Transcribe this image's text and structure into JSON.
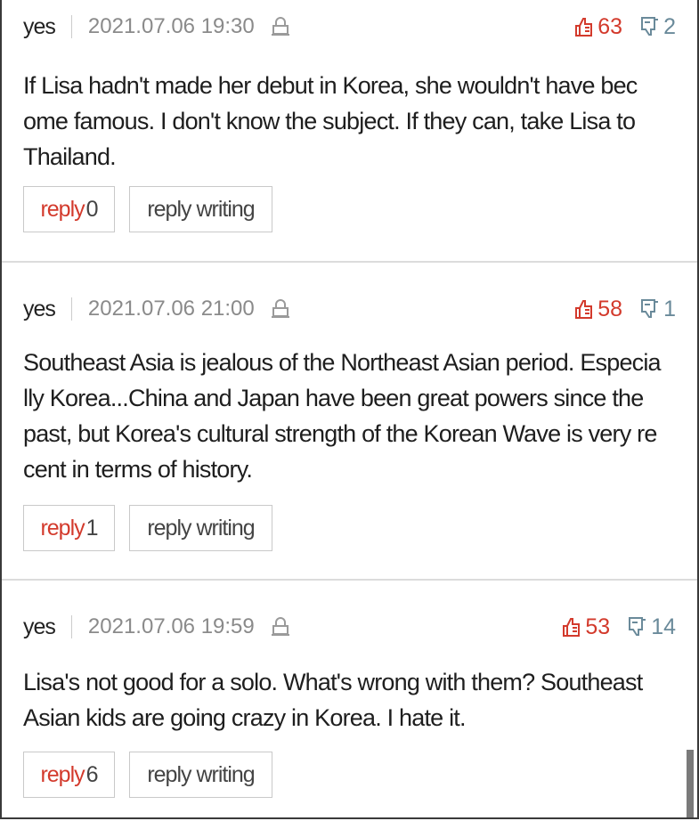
{
  "colors": {
    "accent_red": "#d33a2c",
    "downvote_blue": "#6a8a9a",
    "meta_gray": "#8a8a8a",
    "border": "#c9c9c9"
  },
  "comments": [
    {
      "author": "yes",
      "date": "2021.07.06 19:30",
      "upvotes": "63",
      "downvotes": "2",
      "text": "If Lisa hadn't made her debut in Korea, she wouldn't have bec\nome famous. I don't know the subject. If they can, take Lisa to\nThailand.",
      "reply_label": "reply",
      "reply_count": "0",
      "reply_writing_label": "reply writing"
    },
    {
      "author": "yes",
      "date": "2021.07.06 21:00",
      "upvotes": "58",
      "downvotes": "1",
      "text": "Southeast Asia is jealous of the Northeast Asian period. Especia\nlly Korea...China and Japan have been great powers since the\npast, but Korea's cultural strength of the Korean Wave is very re\ncent in terms of history.",
      "reply_label": "reply",
      "reply_count": "1",
      "reply_writing_label": "reply writing"
    },
    {
      "author": "yes",
      "date": "2021.07.06 19:59",
      "upvotes": "53",
      "downvotes": "14",
      "text": "Lisa's not good for a solo. What's wrong with them? Southeast\nAsian kids are going crazy in Korea. I hate it.",
      "reply_label": "reply",
      "reply_count": "6",
      "reply_writing_label": "reply writing"
    }
  ],
  "icons": {
    "lock": "lock-icon",
    "upvote": "thumbs-up-icon",
    "downvote": "thumbs-down-icon"
  }
}
